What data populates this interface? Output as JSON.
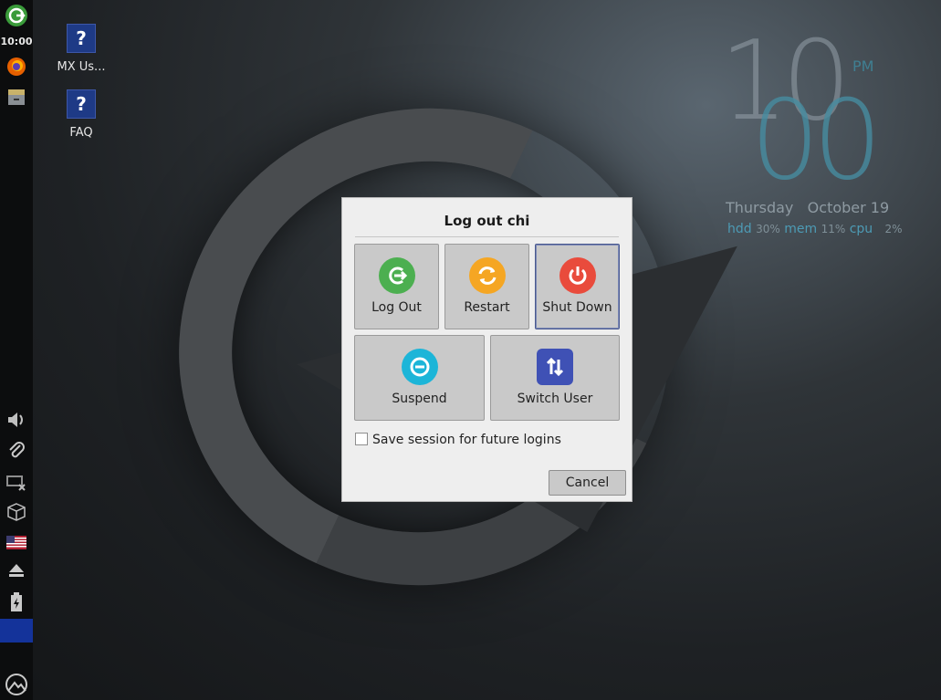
{
  "panel": {
    "clock": "10:00",
    "tray": [
      "volume-icon",
      "clipboard-icon",
      "network-disconnected-icon",
      "package-updates-icon",
      "us-flag-icon",
      "eject-icon",
      "battery-icon",
      "mx-logo-icon"
    ]
  },
  "desktop_icons": [
    {
      "label": "MX Us...",
      "icon": "help-icon"
    },
    {
      "label": "FAQ",
      "icon": "help-icon"
    }
  ],
  "conky": {
    "hour": "10",
    "minute": "00",
    "ampm": "PM",
    "day": "Thursday",
    "date": "October 19",
    "hdd_label": "hdd",
    "hdd_value": "30%",
    "mem_label": "mem",
    "mem_value": "11%",
    "cpu_label": "cpu",
    "cpu_value": "2%"
  },
  "dialog": {
    "title": "Log out chi",
    "buttons": [
      {
        "label": "Log Out",
        "icon": "logout-icon",
        "color": "#4caf50"
      },
      {
        "label": "Restart",
        "icon": "restart-icon",
        "color": "#f5a623"
      },
      {
        "label": "Shut Down",
        "icon": "power-icon",
        "color": "#e94b3c"
      },
      {
        "label": "Suspend",
        "icon": "suspend-icon",
        "color": "#1cb5d8"
      },
      {
        "label": "Switch User",
        "icon": "switch-user-icon",
        "color": "#3f51b5"
      }
    ],
    "save_session_label": "Save session for future logins",
    "save_session_checked": false,
    "cancel_label": "Cancel"
  },
  "colors": {
    "panel_bg": "#0c0d0e",
    "panel_highlight": "#14339a",
    "accent": "#4d9bb5"
  }
}
